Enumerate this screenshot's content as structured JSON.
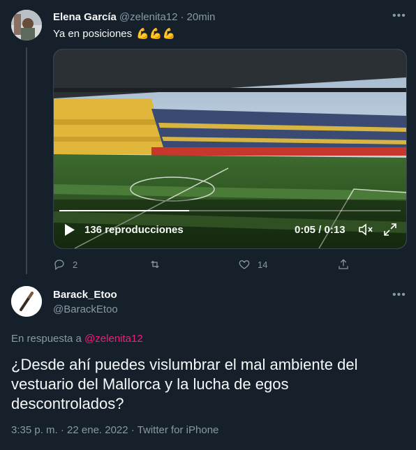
{
  "tweet": {
    "author_name": "Elena García",
    "author_handle": "@zelenita12",
    "separator": "·",
    "time": "20min",
    "text": "Ya en posiciones",
    "emoji": "💪💪💪",
    "video": {
      "views": "136 reproducciones",
      "current_time": "0:05",
      "duration": "0:13",
      "progress": 0.38
    },
    "actions": {
      "replies": "2",
      "retweets": "",
      "likes": "14"
    }
  },
  "reply": {
    "author_name": "Barack_Etoo",
    "author_handle": "@BarackEtoo",
    "replying_to_prefix": "En respuesta a",
    "replying_to_handle": "@zelenita12",
    "text": "¿Desde ahí puedes vislumbrar el mal ambiente del vestuario del Mallorca y la lucha de egos descontrolados?",
    "timestamp": "3:35 p. m. · 22 ene. 2022 · Twitter for iPhone"
  },
  "colors": {
    "background": "#15202b",
    "text": "#f7f9f9",
    "muted": "#8b98a5",
    "mention": "#f91880",
    "border": "#38444d"
  }
}
